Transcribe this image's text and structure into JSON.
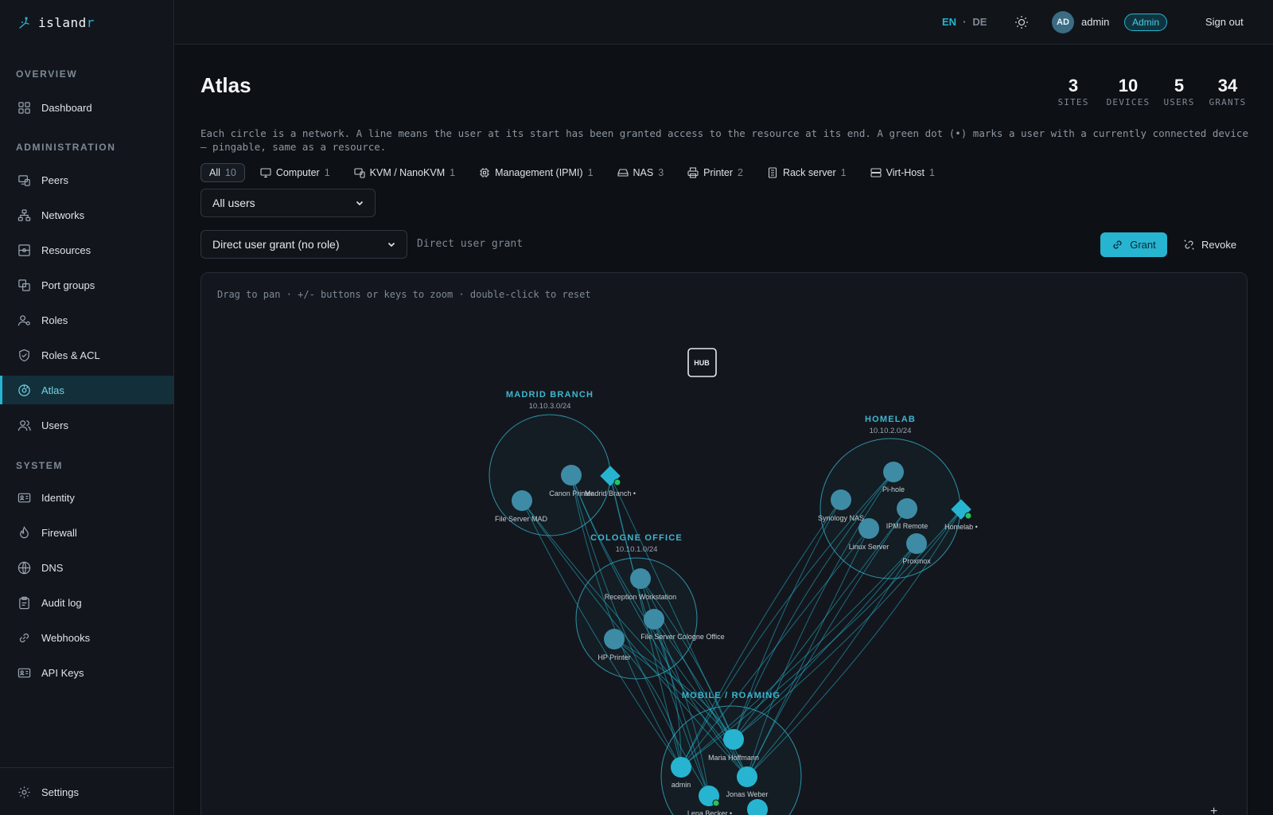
{
  "app": {
    "logo_prefix": "island",
    "logo_accent": "r"
  },
  "sidebar": {
    "sections": {
      "overview": "OVERVIEW",
      "administration": "ADMINISTRATION",
      "system": "SYSTEM"
    },
    "items": [
      {
        "label": "Dashboard",
        "icon": "grid-icon"
      },
      {
        "label": "Peers",
        "icon": "peers-icon"
      },
      {
        "label": "Networks",
        "icon": "network-icon"
      },
      {
        "label": "Resources",
        "icon": "resources-icon"
      },
      {
        "label": "Port groups",
        "icon": "port-groups-icon"
      },
      {
        "label": "Roles",
        "icon": "roles-icon"
      },
      {
        "label": "Roles & ACL",
        "icon": "shield-icon"
      },
      {
        "label": "Atlas",
        "icon": "atlas-icon",
        "active": true
      },
      {
        "label": "Users",
        "icon": "users-icon"
      },
      {
        "label": "Identity",
        "icon": "id-card-icon"
      },
      {
        "label": "Firewall",
        "icon": "flame-icon"
      },
      {
        "label": "DNS",
        "icon": "globe-icon"
      },
      {
        "label": "Audit log",
        "icon": "clipboard-icon"
      },
      {
        "label": "Webhooks",
        "icon": "link-icon"
      },
      {
        "label": "API Keys",
        "icon": "key-card-icon"
      }
    ],
    "settings": "Settings"
  },
  "topbar": {
    "lang_en": "EN",
    "lang_sep": "·",
    "lang_de": "DE",
    "avatar": "AD",
    "username": "admin",
    "role": "Admin",
    "sign_out": "Sign out"
  },
  "page": {
    "title": "Atlas",
    "stats": [
      {
        "value": "3",
        "label": "SITES"
      },
      {
        "value": "10",
        "label": "DEVICES"
      },
      {
        "value": "5",
        "label": "USERS"
      },
      {
        "value": "34",
        "label": "GRANTS"
      }
    ],
    "description": "Each circle is a network. A line means the user at its start has been granted access to the resource at its end. A green dot (•) marks a user with a currently connected device — pingable, same as a resource."
  },
  "filters": [
    {
      "label": "All",
      "count": "10",
      "selected": true
    },
    {
      "label": "Computer",
      "count": "1",
      "icon": "monitor-icon"
    },
    {
      "label": "KVM / NanoKVM",
      "count": "1",
      "icon": "kvm-icon"
    },
    {
      "label": "Management (IPMI)",
      "count": "1",
      "icon": "chip-icon"
    },
    {
      "label": "NAS",
      "count": "3",
      "icon": "nas-icon"
    },
    {
      "label": "Printer",
      "count": "2",
      "icon": "printer-icon"
    },
    {
      "label": "Rack server",
      "count": "1",
      "icon": "rack-icon"
    },
    {
      "label": "Virt-Host",
      "count": "1",
      "icon": "server-icon"
    }
  ],
  "controls": {
    "user_filter": "All users",
    "grant_mode": "Direct user grant (no role)",
    "grant_hint": "Direct user grant",
    "grant_button": "Grant",
    "revoke_button": "Revoke"
  },
  "atlas": {
    "hint": "Drag to pan · +/- buttons or keys to zoom · double-click to reset",
    "hub_label": "HUB",
    "zoom_in": "+",
    "colors": {
      "resource": "#3e8ba6",
      "user": "#27b4d1",
      "online": "#22c55e",
      "edge": "#27b4d1"
    },
    "networks": [
      {
        "name": "MADRID BRANCH",
        "cidr": "10.10.3.0/24"
      },
      {
        "name": "COLOGNE OFFICE",
        "cidr": "10.10.1.0/24"
      },
      {
        "name": "HOMELAB",
        "cidr": "10.10.2.0/24"
      },
      {
        "name": "MOBILE / ROAMING",
        "cidr": ""
      }
    ],
    "nodes": [
      {
        "label": "Canon Printer",
        "kind": "resource"
      },
      {
        "label": "File Server MAD",
        "kind": "resource"
      },
      {
        "label": "Madrid Branch •",
        "kind": "gateway"
      },
      {
        "label": "Reception Workstation",
        "kind": "resource"
      },
      {
        "label": "File Server Cologne Office",
        "kind": "resource"
      },
      {
        "label": "HP Printer",
        "kind": "resource"
      },
      {
        "label": "Pi-hole",
        "kind": "resource"
      },
      {
        "label": "Synology NAS",
        "kind": "resource"
      },
      {
        "label": "IPMI Remote",
        "kind": "resource"
      },
      {
        "label": "Linux Server",
        "kind": "resource"
      },
      {
        "label": "Proxmox",
        "kind": "resource"
      },
      {
        "label": "Homelab •",
        "kind": "gateway"
      },
      {
        "label": "Maria Hoffmann",
        "kind": "user"
      },
      {
        "label": "admin",
        "kind": "user"
      },
      {
        "label": "Jonas Weber",
        "kind": "user"
      },
      {
        "label": "Lena Becker •",
        "kind": "user"
      },
      {
        "label": "",
        "kind": "user"
      }
    ]
  }
}
